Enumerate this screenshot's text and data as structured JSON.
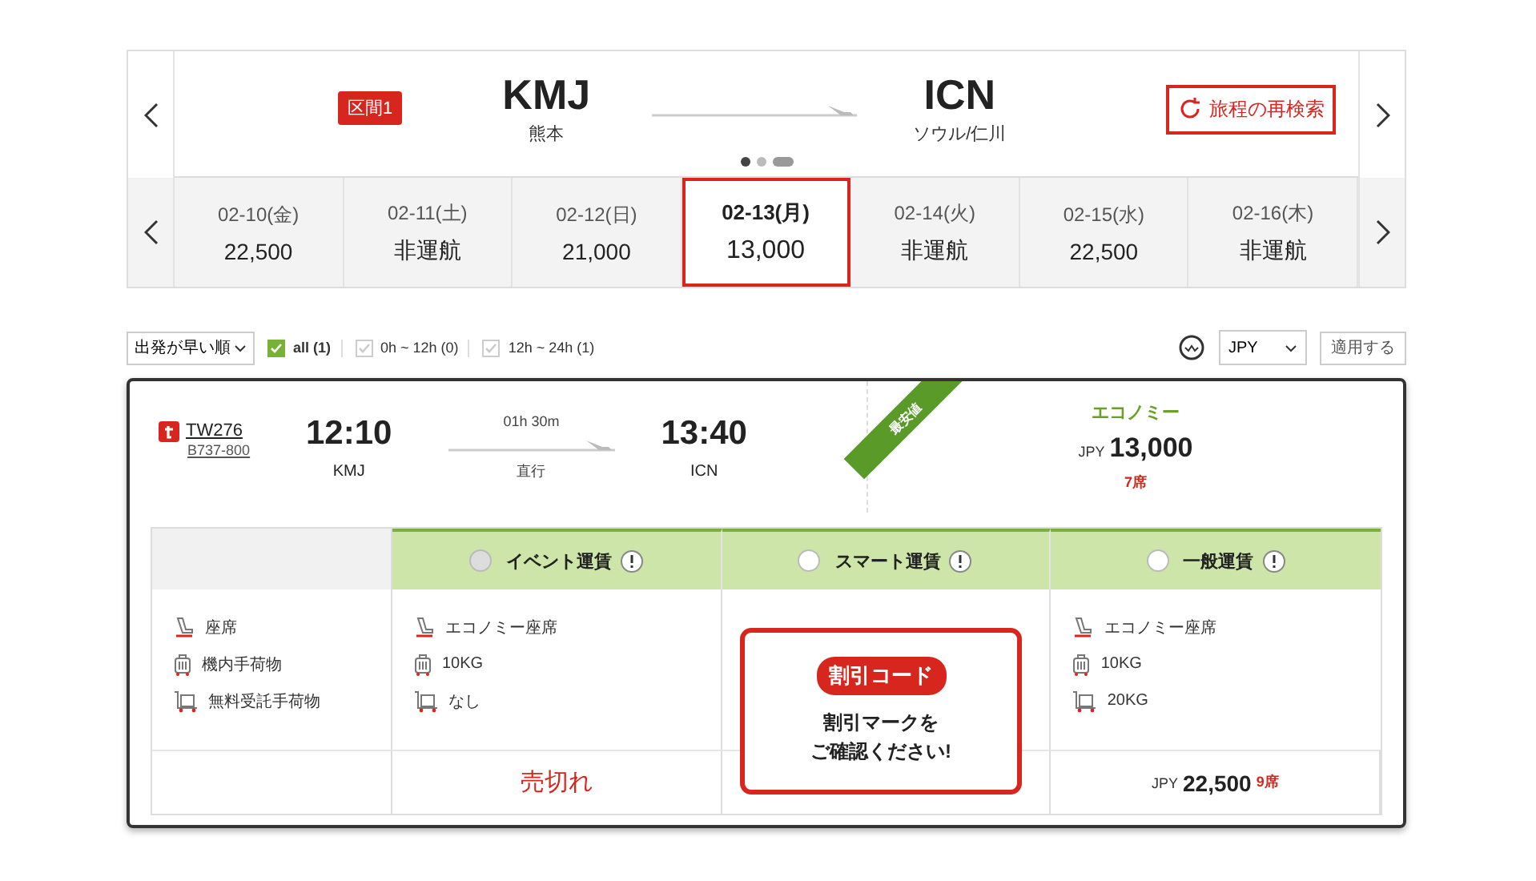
{
  "route": {
    "segment_badge": "区間1",
    "origin": {
      "code": "KMJ",
      "city": "熊本"
    },
    "destination": {
      "code": "ICN",
      "city": "ソウル/仁川"
    },
    "research_button": "旅程の再検索",
    "pager_dots": [
      {
        "selected": true
      },
      {
        "selected": false
      },
      {
        "selected": false,
        "kind": "add"
      }
    ]
  },
  "dates": [
    {
      "date": "02-10(金)",
      "price": "22,500",
      "selected": false
    },
    {
      "date": "02-11(土)",
      "price": "非運航",
      "selected": false
    },
    {
      "date": "02-12(日)",
      "price": "21,000",
      "selected": false
    },
    {
      "date": "02-13(月)",
      "price": "13,000",
      "selected": true
    },
    {
      "date": "02-14(火)",
      "price": "非運航",
      "selected": false
    },
    {
      "date": "02-15(水)",
      "price": "22,500",
      "selected": false
    },
    {
      "date": "02-16(木)",
      "price": "非運航",
      "selected": false
    }
  ],
  "filters": {
    "sort": "出発が早い順",
    "time_filters": [
      {
        "label": "all (1)",
        "checked": true
      },
      {
        "label": "0h ~ 12h (0)",
        "checked": false
      },
      {
        "label": "12h ~ 24h (1)",
        "checked": false
      }
    ],
    "currency": "JPY",
    "apply_button": "適用する"
  },
  "flight": {
    "number": "TW276",
    "aircraft": "B737-800",
    "departure": {
      "time": "12:10",
      "airport": "KMJ"
    },
    "duration": "01h 30m",
    "stops": "直行",
    "arrival": {
      "time": "13:40",
      "airport": "ICN"
    },
    "ribbon": "最安値",
    "cabin": "エコノミー",
    "currency": "JPY",
    "price": "13,000",
    "seats": "7席"
  },
  "fare_table": {
    "row_labels": [
      {
        "kind": "seat",
        "label": "座席"
      },
      {
        "kind": "cabin_bag",
        "label": "機内手荷物"
      },
      {
        "kind": "checked_bag",
        "label": "無料受託手荷物"
      }
    ],
    "fares": [
      {
        "name": "イベント運賃",
        "disabled": true,
        "selected": false,
        "features": [
          "エコノミー座席",
          "10KG",
          "なし"
        ],
        "status": "売切れ"
      },
      {
        "name": "スマート運賃",
        "disabled": false,
        "selected": false
      },
      {
        "name": "一般運賃",
        "disabled": false,
        "selected": false,
        "features": [
          "エコノミー座席",
          "10KG",
          "20KG"
        ],
        "currency": "JPY",
        "price": "22,500",
        "seats": "9席"
      }
    ]
  },
  "promo": {
    "badge": "割引コード",
    "message": [
      "割引マークを",
      "ご確認ください!"
    ]
  }
}
